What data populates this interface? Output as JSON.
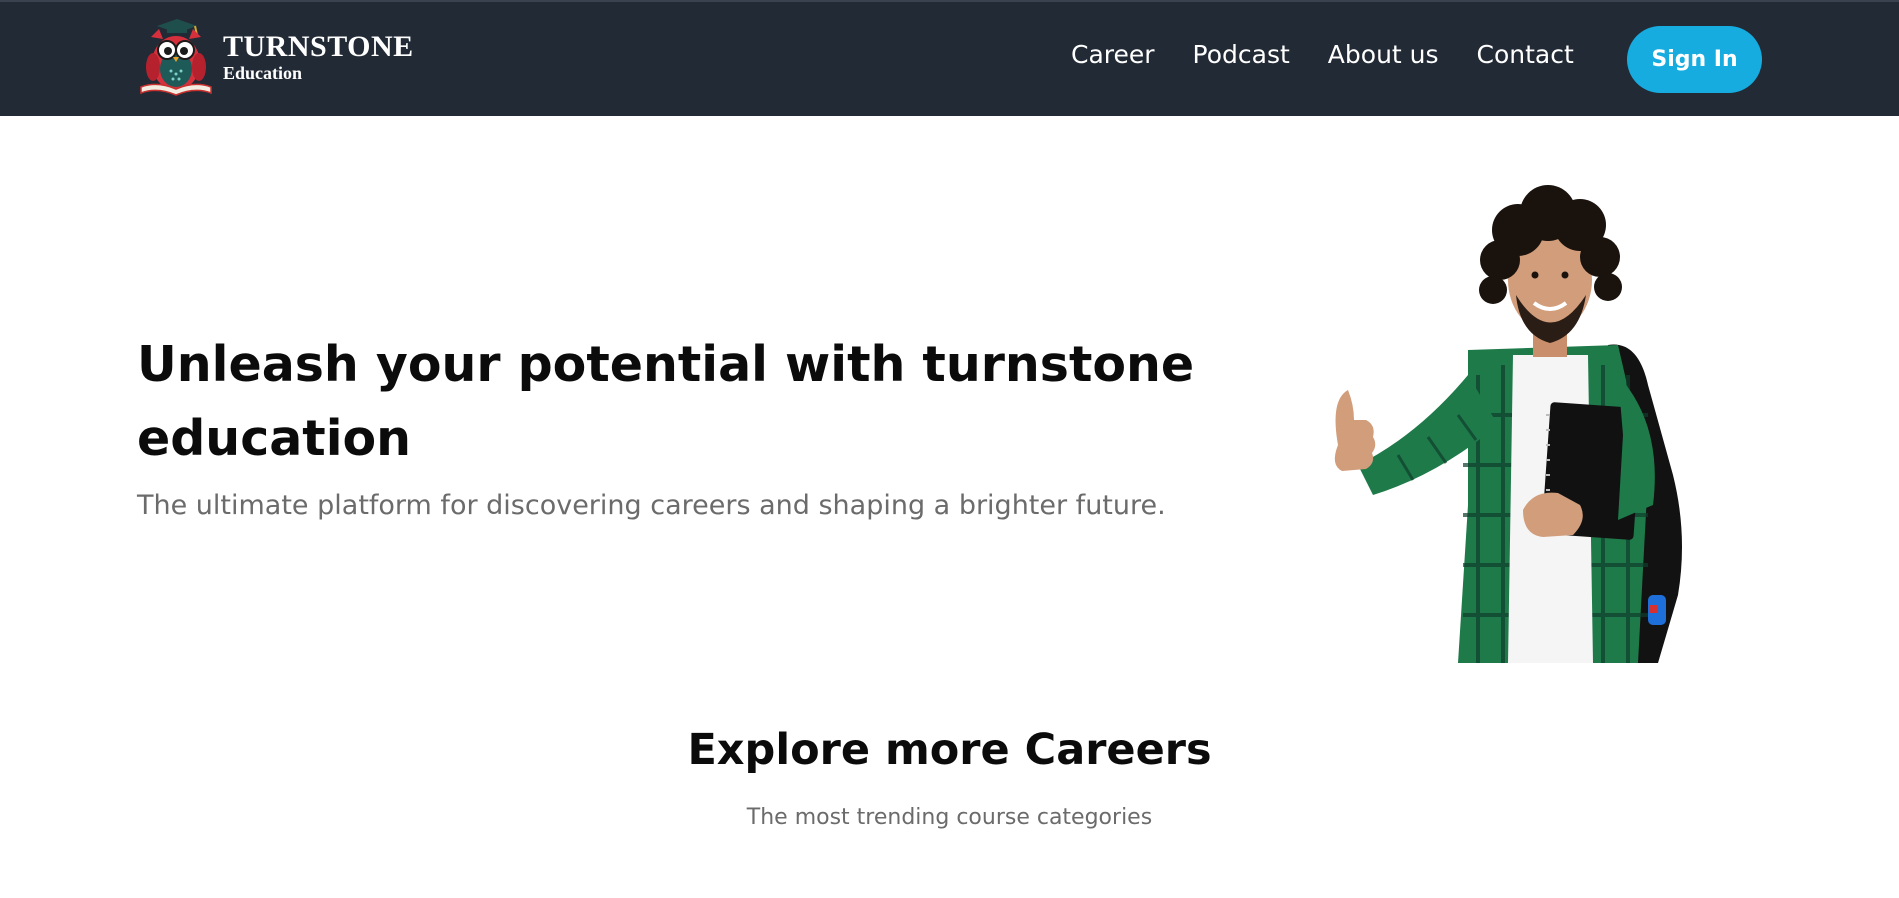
{
  "brand": {
    "title": "TURNSTONE",
    "subtitle": "Education"
  },
  "nav": {
    "links": [
      {
        "label": "Career"
      },
      {
        "label": "Podcast"
      },
      {
        "label": "About us"
      },
      {
        "label": "Contact"
      }
    ],
    "signin_label": "Sign In"
  },
  "hero": {
    "title": "Unleash your potential with turnstone education",
    "subtitle": "The ultimate platform for discovering careers and shaping a brighter future.",
    "image_icon": "student-thumbs-up-photo"
  },
  "explore": {
    "title": "Explore more Careers",
    "subtitle": "The most trending course categories"
  },
  "colors": {
    "header_bg": "#222a36",
    "accent": "#16ace0",
    "heading": "#0b0b0b",
    "muted_text": "#6b6b6b"
  }
}
